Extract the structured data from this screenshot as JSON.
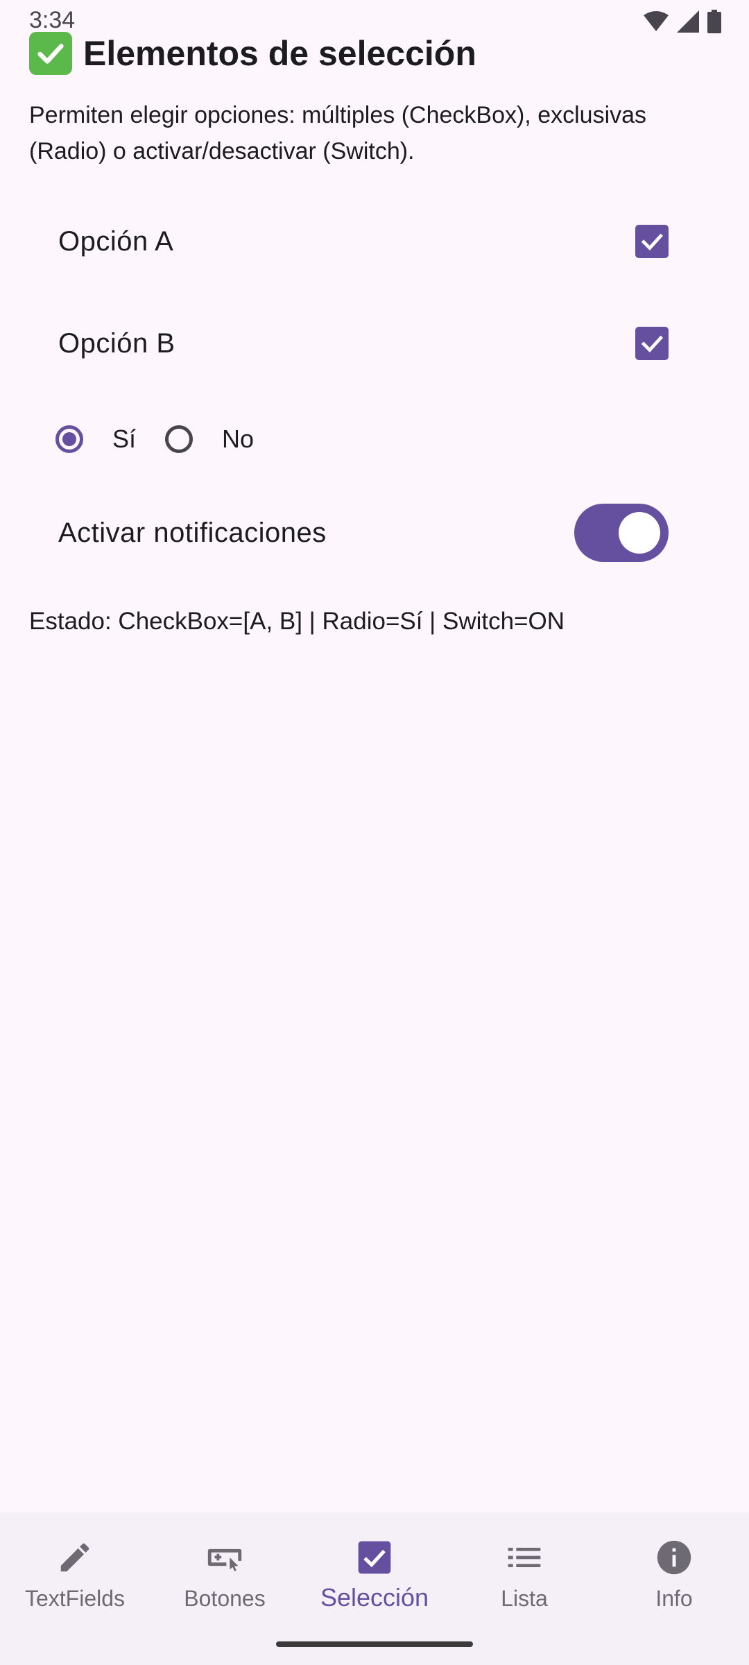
{
  "status_bar": {
    "time": "3:34"
  },
  "header": {
    "emoji_icon": "check-mark-button-icon",
    "title": "Elementos de selección",
    "description": "Permiten elegir opciones: múltiples (CheckBox), exclusivas (Radio) o activar/desactivar (Switch)."
  },
  "checkboxes": [
    {
      "label": "Opción A",
      "checked": true
    },
    {
      "label": "Opción B",
      "checked": true
    }
  ],
  "radio": {
    "options": [
      {
        "label": "Sí",
        "selected": true
      },
      {
        "label": "No",
        "selected": false
      }
    ]
  },
  "switch": {
    "label": "Activar notificaciones",
    "on": true
  },
  "status_text": "Estado: CheckBox=[A, B] | Radio=Sí | Switch=ON",
  "bottom_nav": {
    "items": [
      {
        "label": "TextFields",
        "icon": "pencil-icon",
        "active": false
      },
      {
        "label": "Botones",
        "icon": "gamepad-icon",
        "active": false
      },
      {
        "label": "Selección",
        "icon": "checkbox-icon",
        "active": true
      },
      {
        "label": "Lista",
        "icon": "list-icon",
        "active": false
      },
      {
        "label": "Info",
        "icon": "info-icon",
        "active": false
      }
    ]
  },
  "colors": {
    "accent": "#65509f",
    "background": "#fdf7fd",
    "nav_background": "#f5eff7",
    "inactive": "#6e6a74"
  }
}
